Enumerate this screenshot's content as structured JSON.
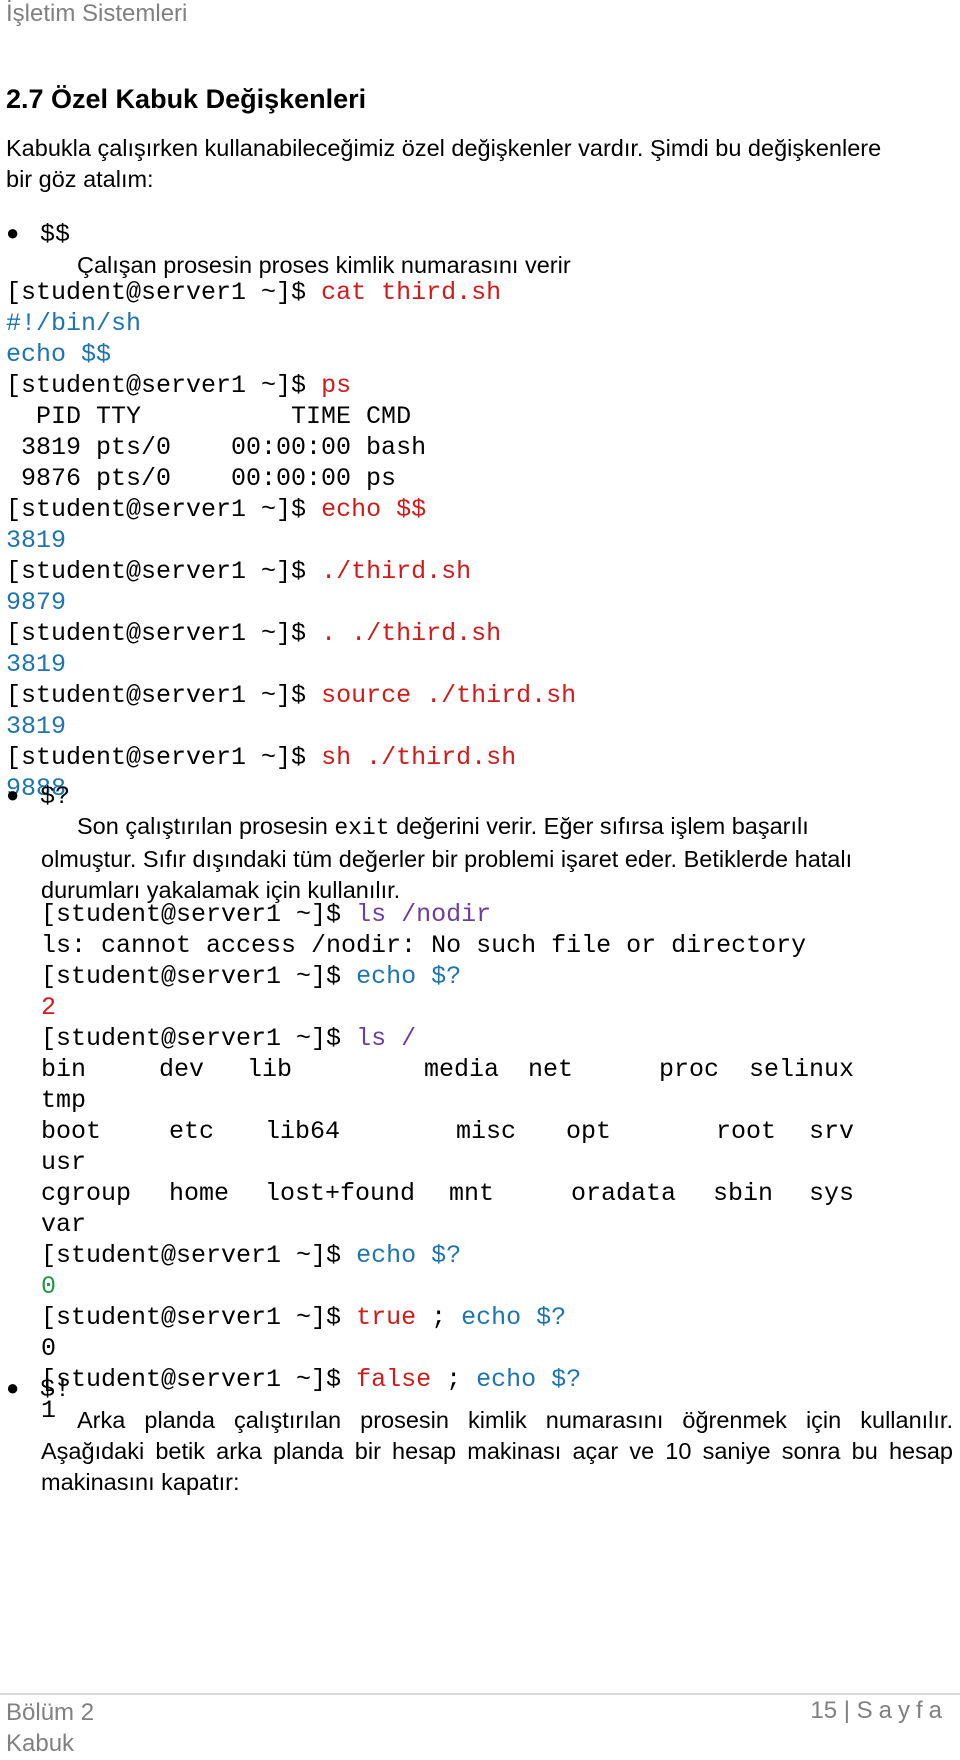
{
  "header": {
    "title": "İşletim Sistemleri"
  },
  "section": {
    "heading": "2.7 Özel Kabuk Değişkenleri",
    "intro_line1": "Kabukla çalışırken kullanabileceğimiz özel değişkenler vardır. Şimdi bu değişkenlere",
    "intro_line2": "bir göz atalım:"
  },
  "items": [
    {
      "symbol": "$$",
      "description": "Çalışan prosesin proses kimlik numarasını verir",
      "terminal": [
        {
          "prompt": "[student@server1 ~]$ ",
          "cmd": "cat third.sh"
        },
        {
          "out": "#!/bin/sh",
          "color": "blue"
        },
        {
          "out": "echo $$",
          "color": "blue"
        },
        {
          "prompt": "[student@server1 ~]$ ",
          "cmd": "ps"
        },
        {
          "out": "  PID TTY          TIME CMD",
          "color": "dark"
        },
        {
          "out": " 3819 pts/0    00:00:00 bash",
          "color": "dark"
        },
        {
          "out": " 9876 pts/0    00:00:00 ps",
          "color": "dark"
        },
        {
          "prompt": "[student@server1 ~]$ ",
          "cmd": "echo $$"
        },
        {
          "out": "3819",
          "color": "blue"
        },
        {
          "prompt": "[student@server1 ~]$ ",
          "cmd": "./third.sh"
        },
        {
          "out": "9879",
          "color": "blue"
        },
        {
          "prompt": "[student@server1 ~]$ ",
          "cmd": ". ./third.sh"
        },
        {
          "out": "3819",
          "color": "blue"
        },
        {
          "prompt": "[student@server1 ~]$ ",
          "cmd": "source ./third.sh"
        },
        {
          "out": "3819",
          "color": "blue"
        },
        {
          "prompt": "[student@server1 ~]$ ",
          "cmd": "sh ./third.sh"
        },
        {
          "out": "9888",
          "color": "blue"
        }
      ]
    },
    {
      "symbol": "$?",
      "description_pre": "Son çalıştırılan prosesin ",
      "description_code": "exit",
      "description_post": " değerini verir. Eğer sıfırsa işlem başarılı",
      "description_line2": "olmuştur. Sıfır dışındaki tüm değerler bir problemi işaret eder. Betiklerde hatalı",
      "description_line3": "durumları yakalamak için kullanılır.",
      "terminal": [
        {
          "prompt": "[student@server1 ~]$ ",
          "cmd": "ls /nodir",
          "cmdcolor": "purple"
        },
        {
          "out": "ls: cannot access /nodir: No such file or directory",
          "color": "dark"
        },
        {
          "prompt": "[student@server1 ~]$ ",
          "cmd": "echo $?",
          "cmdcolor": "blue"
        },
        {
          "out": "2",
          "color": "red"
        },
        {
          "prompt": "[student@server1 ~]$ ",
          "cmd": "ls /",
          "cmdcolor": "purple"
        },
        {
          "cols": [
            "bin",
            "dev",
            "lib",
            "media",
            "net",
            "proc",
            "selinux"
          ]
        },
        {
          "out": "tmp",
          "color": "dark"
        },
        {
          "cols": [
            "boot",
            "etc",
            "lib64",
            "misc",
            "opt",
            "root",
            "srv"
          ]
        },
        {
          "out": "usr",
          "color": "dark"
        },
        {
          "cols": [
            "cgroup",
            "home",
            "lost+found",
            "mnt",
            "oradata",
            "sbin",
            "sys"
          ]
        },
        {
          "out": "var",
          "color": "dark"
        },
        {
          "prompt": "[student@server1 ~]$ ",
          "cmd": "echo $?",
          "cmdcolor": "blue"
        },
        {
          "out": "0",
          "color": "green"
        },
        {
          "prompt": "[student@server1 ~]$ ",
          "cmd": "true",
          "cmdcolor": "red",
          "cmd2": " ; ",
          "cmd3": "echo $?"
        },
        {
          "out": "0",
          "color": "dark"
        },
        {
          "prompt": "[student@server1 ~]$ ",
          "cmd": "false",
          "cmdcolor": "red",
          "cmd2": " ; ",
          "cmd3": "echo $?"
        },
        {
          "out": "1",
          "color": "dark"
        }
      ]
    },
    {
      "symbol": "$!",
      "description_line1": "Arka planda çalıştırılan prosesin kimlik numarasını öğrenmek için kullanılır.",
      "description_line2": "Aşağıdaki betik arka planda bir hesap makinası açar ve 10 saniye sonra bu hesap",
      "description_line3": "makinasını kapatır:"
    }
  ],
  "footer": {
    "chapter": "Bölüm 2",
    "chapter_name": "Kabuk",
    "page_number": "15",
    "separator": "|",
    "page_label": "Sayfa"
  },
  "colors": {
    "command_red": "#d11a1a",
    "output_blue": "#1e74b0",
    "command_purple": "#6b3fa0",
    "output_green": "#1a9a45",
    "header_gray": "#808080"
  }
}
